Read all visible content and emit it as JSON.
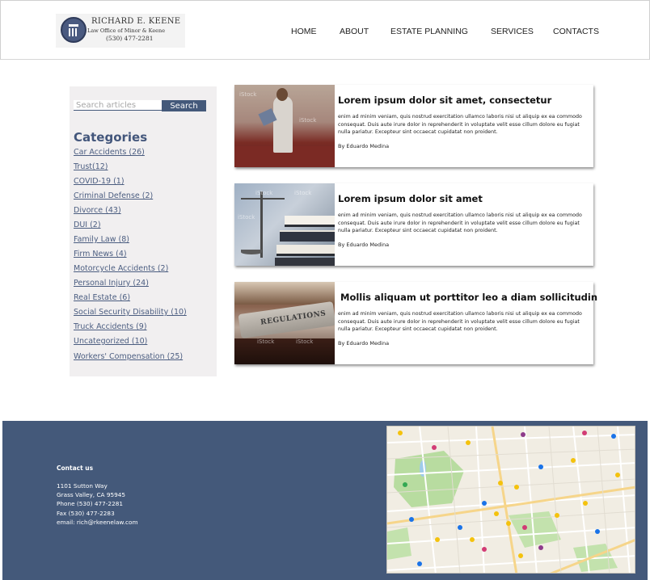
{
  "header": {
    "logo": {
      "name": "RICHARD E. KEENE",
      "subtitle": "Law Office of Minor & Keene",
      "phone": "(530) 477-2281"
    },
    "nav": [
      "HOME",
      "ABOUT",
      "ESTATE PLANNING",
      "SERVICES",
      "CONTACTS"
    ]
  },
  "sidebar": {
    "search": {
      "placeholder": "Search articles",
      "button_label": "Search"
    },
    "categories_title": "Categories",
    "categories": [
      "Car Accidents (26)",
      "Trust(12)",
      "COVID-19 (1)",
      "Criminal Defense (2)",
      "Divorce (43)",
      "DUI (2)",
      "Family Law (8)",
      "Firm News (4)",
      "Motorcycle Accidents (2)",
      "Personal Injury (24)",
      "Real Estate (6)",
      "Social Security Disability (10)",
      "Truck Accidents (9)",
      "Uncategorized (10)",
      "Workers' Compensation (25)"
    ]
  },
  "posts": [
    {
      "title": "Lorem ipsum dolor sit amet, consectetur",
      "excerpt": "enim ad minim veniam, quis nostrud exercitation ullamco laboris nisi ut aliquip ex ea commodo consequat. Duis aute irure dolor in reprehenderit in voluptate velit esse cillum dolore eu fugiat nulla pariatur. Excepteur sint occaecat cupidatat non proident.",
      "author": "By Eduardo Medina",
      "image": "speaker-at-podium"
    },
    {
      "title": "Lorem ipsum dolor sit amet",
      "excerpt": "enim ad minim veniam, quis nostrud exercitation ullamco laboris nisi ut aliquip ex ea commodo consequat. Duis aute irure dolor in reprehenderit in voluptate velit esse cillum dolore eu fugiat nulla pariatur. Excepteur sint occaecat cupidatat non proident.",
      "author": "By Eduardo Medina",
      "image": "scales-and-books"
    },
    {
      "title": "Mollis aliquam ut porttitor leo a diam sollicitudin",
      "excerpt": "enim ad minim veniam, quis nostrud exercitation ullamco laboris nisi ut aliquip ex ea commodo consequat. Duis aute irure dolor in reprehenderit in voluptate velit esse cillum dolore eu fugiat nulla pariatur. Excepteur sint occaecat cupidatat non proident.",
      "author": "By Eduardo Medina",
      "image": "regulations-book",
      "image_label": "REGULATIONS"
    }
  ],
  "watermark": "iStock",
  "footer": {
    "contact_title": "Contact us",
    "lines": [
      "1101 Sutton Way",
      "Grass Valley, CA 95945",
      "Phone (530) 477-2281",
      "Fax  (530) 477-2283",
      "email: rich@rkeenelaw.com"
    ],
    "map": "city-map"
  },
  "colors": {
    "brand": "#44597a",
    "sidebar_bg": "#f1eff0",
    "link": "#4b5d80"
  }
}
